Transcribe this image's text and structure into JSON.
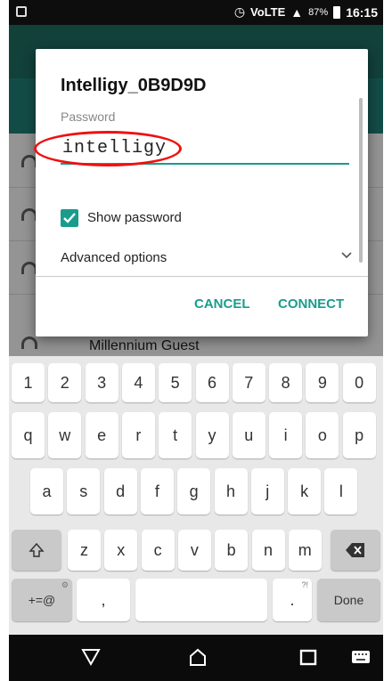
{
  "status_bar": {
    "carrier_text": "VoLTE",
    "battery_percent": "87%",
    "time": "16:15"
  },
  "dialog": {
    "network_name": "Intelligy_0B9D9D",
    "password_label": "Password",
    "password_value": "intelligy",
    "show_password_label": "Show password",
    "show_password_checked": true,
    "advanced_options_label": "Advanced options",
    "cancel_label": "CANCEL",
    "connect_label": "CONNECT",
    "accent_color": "#1a9c8c"
  },
  "background": {
    "partial_network_label": "Millennium Guest"
  },
  "keyboard": {
    "row_numbers": [
      "1",
      "2",
      "3",
      "4",
      "5",
      "6",
      "7",
      "8",
      "9",
      "0"
    ],
    "row_top": [
      "q",
      "w",
      "e",
      "r",
      "t",
      "y",
      "u",
      "i",
      "o",
      "p"
    ],
    "row_middle": [
      "a",
      "s",
      "d",
      "f",
      "g",
      "h",
      "j",
      "k",
      "l"
    ],
    "row_bottom": [
      "z",
      "x",
      "c",
      "v",
      "b",
      "n",
      "m"
    ],
    "symbols_key": "+=@",
    "comma_key": ",",
    "period_key": ".",
    "done_key": "Done"
  },
  "nav_bar": {
    "back_icon": "back-triangle-icon",
    "home_icon": "home-icon",
    "recents_icon": "recents-square-icon",
    "keyboard_icon": "keyboard-icon"
  }
}
